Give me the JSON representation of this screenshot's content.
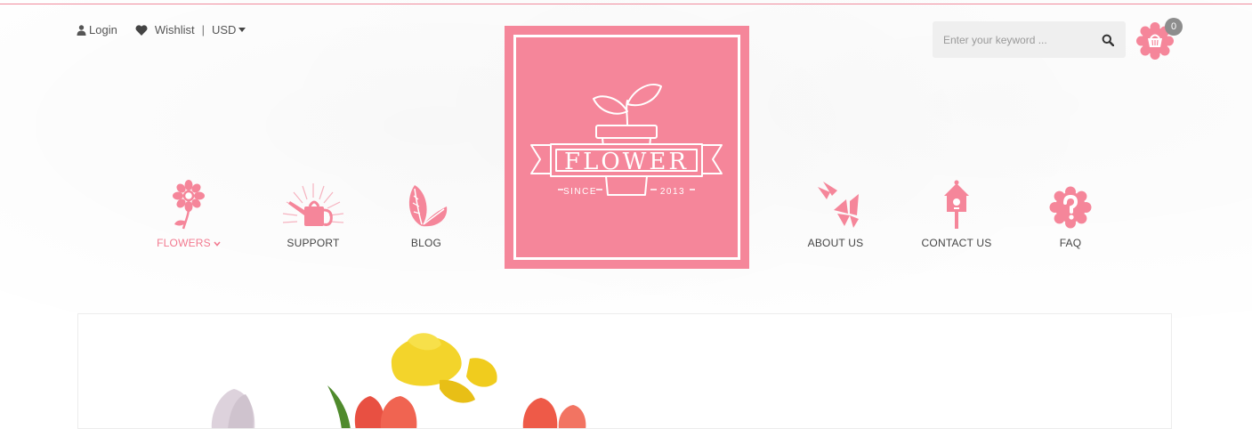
{
  "utility": {
    "login": "Login",
    "wishlist": "Wishlist",
    "divider": "|",
    "currency": "USD"
  },
  "search": {
    "placeholder": "Enter your keyword ..."
  },
  "cart": {
    "count": "0"
  },
  "logo": {
    "word": "FLOWER",
    "since": "SINCE",
    "year": "2013"
  },
  "nav": {
    "left": [
      {
        "label": "FLOWERS",
        "icon": "flower-icon",
        "active": true
      },
      {
        "label": "SUPPORT",
        "icon": "watering-can-icon"
      },
      {
        "label": "BLOG",
        "icon": "leaves-icon"
      }
    ],
    "right": [
      {
        "label": "ABOUT US",
        "icon": "butterflies-icon"
      },
      {
        "label": "CONTACT US",
        "icon": "birdhouse-icon"
      },
      {
        "label": "FAQ",
        "icon": "question-flower-icon"
      }
    ]
  },
  "colors": {
    "accent": "#f5869a",
    "rule": "#f08a9c",
    "badge": "#8d8d8d",
    "search_bg": "#efefef"
  }
}
